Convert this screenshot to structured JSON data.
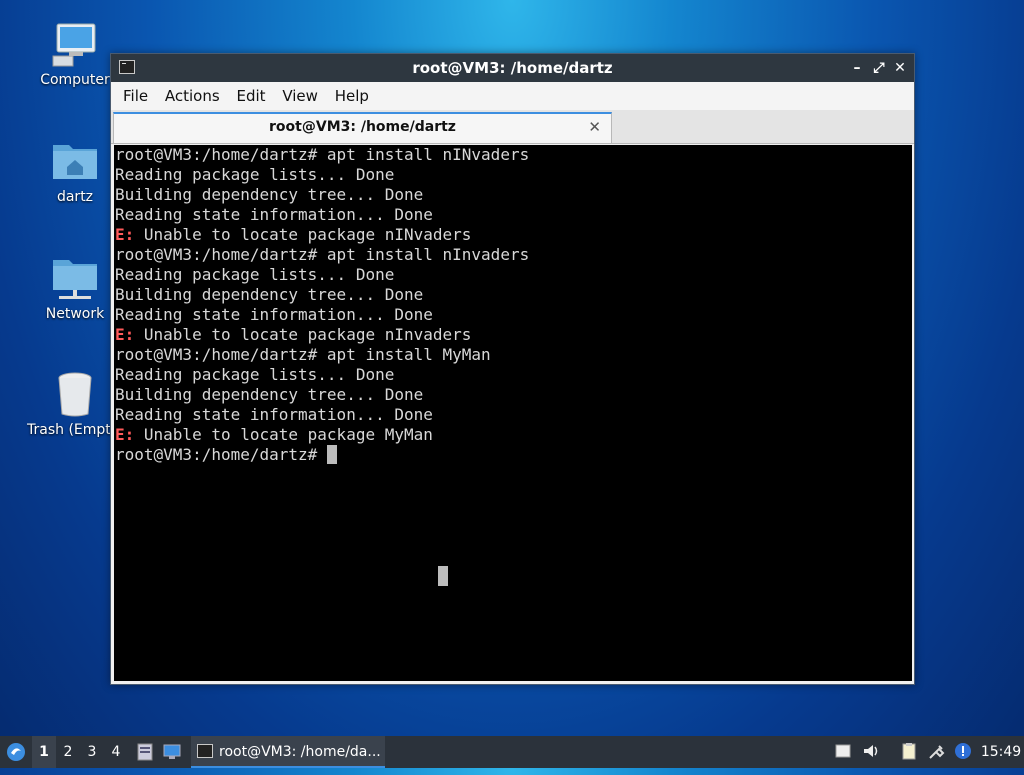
{
  "desktop": {
    "icons": [
      {
        "label": "Computer"
      },
      {
        "label": "dartz"
      },
      {
        "label": "Network"
      },
      {
        "label": "Trash (Empty)"
      }
    ]
  },
  "window": {
    "title": "root@VM3: /home/dartz",
    "controls": {
      "minimize": "–",
      "maximize": "⤢",
      "close": "✕"
    },
    "menu": [
      "File",
      "Actions",
      "Edit",
      "View",
      "Help"
    ],
    "tab": {
      "label": "root@VM3: /home/dartz",
      "close": "✕"
    }
  },
  "terminal": {
    "lines": [
      {
        "prefix": "",
        "text": "root@VM3:/home/dartz# apt install nINvaders"
      },
      {
        "prefix": "",
        "text": "Reading package lists... Done"
      },
      {
        "prefix": "",
        "text": "Building dependency tree... Done"
      },
      {
        "prefix": "",
        "text": "Reading state information... Done"
      },
      {
        "prefix": "E:",
        "text": " Unable to locate package nINvaders"
      },
      {
        "prefix": "",
        "text": "root@VM3:/home/dartz# apt install nInvaders"
      },
      {
        "prefix": "",
        "text": "Reading package lists... Done"
      },
      {
        "prefix": "",
        "text": "Building dependency tree... Done"
      },
      {
        "prefix": "",
        "text": "Reading state information... Done"
      },
      {
        "prefix": "E:",
        "text": " Unable to locate package nInvaders"
      },
      {
        "prefix": "",
        "text": "root@VM3:/home/dartz# apt install MyMan"
      },
      {
        "prefix": "",
        "text": "Reading package lists... Done"
      },
      {
        "prefix": "",
        "text": "Building dependency tree... Done"
      },
      {
        "prefix": "",
        "text": "Reading state information... Done"
      },
      {
        "prefix": "E:",
        "text": " Unable to locate package MyMan"
      }
    ],
    "prompt": "root@VM3:/home/dartz# "
  },
  "taskbar": {
    "workspaces": [
      "1",
      "2",
      "3",
      "4"
    ],
    "active_workspace": "1",
    "task": "root@VM3: /home/da...",
    "clock": "15:49",
    "tray_icons": [
      "notes-icon",
      "volume-icon",
      "clipboard-icon",
      "network-icon",
      "update-icon"
    ]
  },
  "colors": {
    "terminal_bg": "#000000",
    "error": "#ff5a5a",
    "accent": "#3c8ee0"
  }
}
